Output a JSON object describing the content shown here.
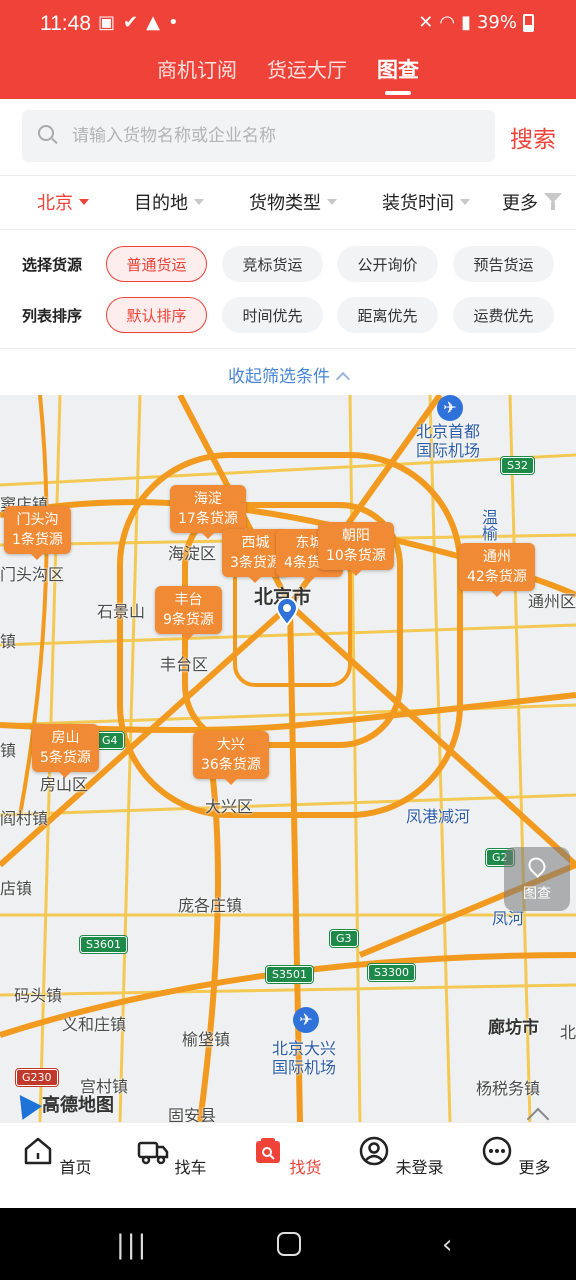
{
  "status": {
    "time": "11:48",
    "battery": "39%"
  },
  "header": {
    "tabs": [
      {
        "label": "商机订阅"
      },
      {
        "label": "货运大厅"
      },
      {
        "label": "图查"
      }
    ],
    "active_tab": "图查"
  },
  "search": {
    "placeholder": "请输入货物名称或企业名称",
    "value": "",
    "button": "搜索"
  },
  "filters": {
    "city": "北京",
    "destination": "目的地",
    "cargo_type": "货物类型",
    "load_time": "装货时间",
    "more": "更多"
  },
  "source_row": {
    "label": "选择货源",
    "chips": [
      "普通货运",
      "竞标货运",
      "公开询价",
      "预告货运"
    ],
    "selected": "普通货运"
  },
  "sort_row": {
    "label": "列表排序",
    "chips": [
      "默认排序",
      "时间优先",
      "距离优先",
      "运费优先"
    ],
    "selected": "默认排序"
  },
  "collapse_label": "收起筛选条件",
  "map": {
    "markers": [
      {
        "district": "海淀",
        "count": "17条货源"
      },
      {
        "district": "门头沟",
        "count": "1条货源"
      },
      {
        "district": "西城",
        "count": "3条货源"
      },
      {
        "district": "东城",
        "count": "4条货源"
      },
      {
        "district": "朝阳",
        "count": "10条货源"
      },
      {
        "district": "通州",
        "count": "42条货源"
      },
      {
        "district": "丰台",
        "count": "9条货源"
      },
      {
        "district": "房山",
        "count": "5条货源"
      },
      {
        "district": "大兴",
        "count": "36条货源"
      }
    ],
    "places": {
      "capital_airport": "北京首都\n国际机场",
      "daxing_airport": "北京大兴\n国际机场",
      "beijing": "北京市",
      "haidian": "海淀区",
      "shijingshan": "石景山",
      "fengtai": "丰台区",
      "mentougou": "门头沟区",
      "fangshan": "房山区",
      "daxing": "大兴区",
      "tongzhou": "通州区",
      "langfang": "廊坊市",
      "pangezhuang": "庞各庄镇",
      "yufa": "榆垡镇",
      "yihezhuang": "义和庄镇",
      "matou": "码头镇",
      "gongcun": "宫村镇",
      "guan": "固安县",
      "yangshuiwu": "杨税务镇",
      "fenggang": "凤港减河",
      "fenghe": "凤河",
      "wenyu": "温榆",
      "town1": "窦店镇",
      "town2": "阎村镇",
      "town3": "店镇",
      "town4": "镇",
      "town5": "镇",
      "north_edge": "北"
    },
    "shields": [
      "S32",
      "G4",
      "G2",
      "G3",
      "S3601",
      "S3501",
      "S3300",
      "G230"
    ],
    "tucha_label": "图查",
    "provider": "高德地图"
  },
  "bottom_nav": [
    {
      "label": "首页",
      "icon": "home-icon"
    },
    {
      "label": "找车",
      "icon": "truck-icon"
    },
    {
      "label": "找货",
      "icon": "cargo-icon"
    },
    {
      "label": "未登录",
      "icon": "user-icon"
    },
    {
      "label": "更多",
      "icon": "more-icon"
    }
  ],
  "active_nav": "找货",
  "colors": {
    "brand": "#ef4238",
    "marker": "#f08a34",
    "link": "#4a86d6"
  }
}
